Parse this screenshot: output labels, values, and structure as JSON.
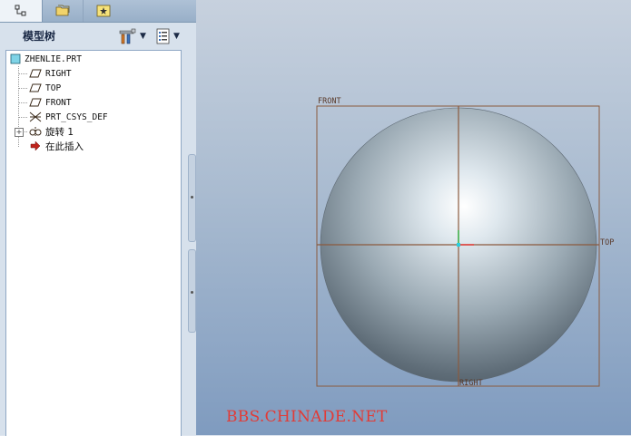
{
  "tabs": [
    {
      "name": "model-tree",
      "icon": "model-tree-icon"
    },
    {
      "name": "folder-browser",
      "icon": "folder-icon"
    },
    {
      "name": "favorites",
      "icon": "favorites-icon"
    }
  ],
  "tree": {
    "title": "模型树",
    "settings_icon": "tools-icon",
    "show_icon": "list-icon",
    "items": [
      {
        "label": "ZHENLIE.PRT",
        "icon": "part-icon"
      },
      {
        "label": "RIGHT",
        "icon": "datum-plane-icon"
      },
      {
        "label": "TOP",
        "icon": "datum-plane-icon"
      },
      {
        "label": "FRONT",
        "icon": "datum-plane-icon"
      },
      {
        "label": "PRT_CSYS_DEF",
        "icon": "csys-icon"
      },
      {
        "label": "旋转 1",
        "icon": "revolve-icon"
      },
      {
        "label": "在此插入",
        "icon": "insert-arrow-icon"
      }
    ]
  },
  "viewport": {
    "plane_labels": {
      "front": "FRONT",
      "top": "TOP",
      "right": "RIGHT"
    },
    "watermark": "BBS.CHINADE.NET",
    "colors": {
      "datum_plane": "#8a5a3e",
      "watermark": "#e23b36"
    }
  }
}
